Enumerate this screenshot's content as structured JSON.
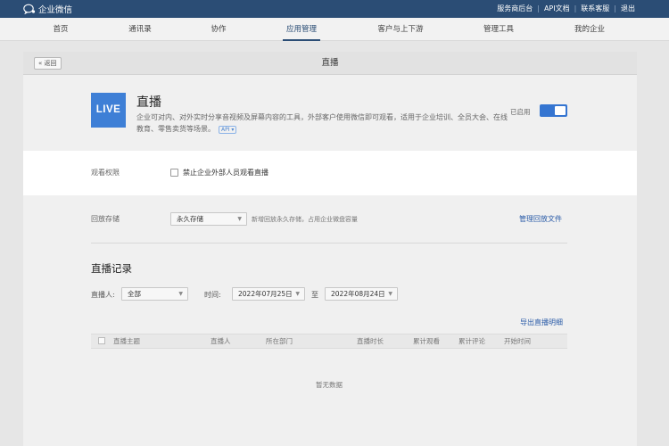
{
  "topbar": {
    "brand": "企业微信",
    "links": [
      "服务商后台",
      "API文档",
      "联系客服",
      "退出"
    ]
  },
  "nav": {
    "items": [
      "首页",
      "通讯录",
      "协作",
      "应用管理",
      "客户与上下游",
      "管理工具",
      "我的企业"
    ],
    "active_index": 3
  },
  "panel": {
    "back_label": "« 返回",
    "title": "直播"
  },
  "app": {
    "logo_text": "LIVE",
    "name": "直播",
    "description": "企业可对内、对外实时分享音视频及屏幕内容的工具，外部客户使用微信即可观看，适用于企业培训、全员大会、在线教育、零售卖货等场景。",
    "api_badge": "API ▾",
    "status_label": "已启用",
    "enabled": true
  },
  "permission": {
    "label": "观看权限",
    "checkbox_label": "禁止企业外部人员观看直播",
    "checked": false
  },
  "playback": {
    "label": "回放存储",
    "select_value": "永久存储",
    "hint": "新增回放永久存储，占用企业微盘容量",
    "manage_link": "管理回放文件"
  },
  "records": {
    "title": "直播记录",
    "host_label": "直播人:",
    "host_value": "全部",
    "time_label": "时间:",
    "date_from": "2022年07月25日",
    "to_label": "至",
    "date_to": "2022年08月24日",
    "export_link": "导出直播明细",
    "columns": [
      "直播主题",
      "直播人",
      "所在部门",
      "直播时长",
      "累计观看",
      "累计评论",
      "开始时间"
    ],
    "empty_text": "暂无数据"
  },
  "colors": {
    "topbar": "#2b4d75",
    "accent": "#3575d1",
    "logo": "#3e7fd6"
  }
}
